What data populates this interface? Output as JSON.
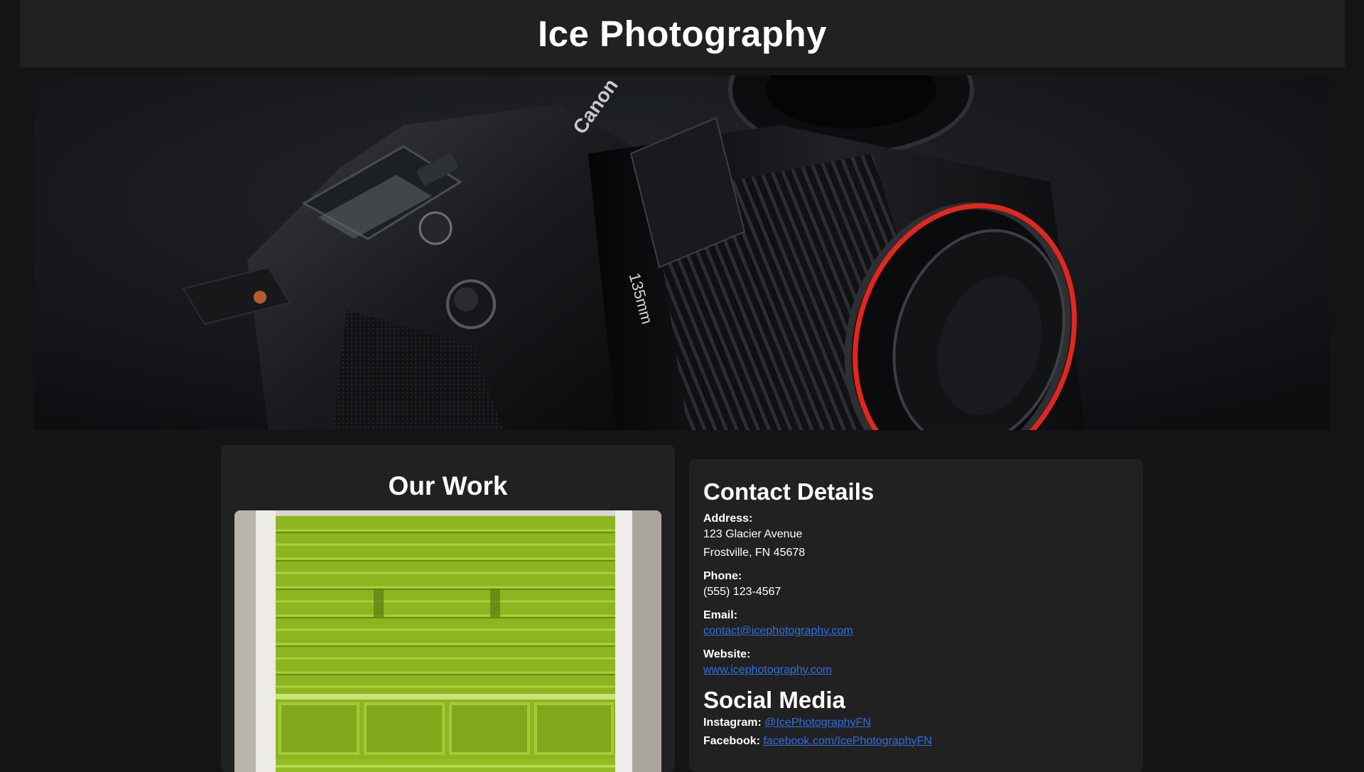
{
  "header": {
    "title": "Ice Photography"
  },
  "hero": {
    "image_alt": "Black Canon camera with a 135mm lens",
    "lens_text": "135mm",
    "brand_text": "Canon"
  },
  "work": {
    "title": "Our Work",
    "image_alt": "Bright green garage door"
  },
  "contact": {
    "title": "Contact Details",
    "address_label": "Address:",
    "address_line1": "123 Glacier Avenue",
    "address_line2": "Frostville, FN 45678",
    "phone_label": "Phone:",
    "phone_value": "(555) 123-4567",
    "email_label": "Email:",
    "email_value": "contact@icephotography.com",
    "website_label": "Website:",
    "website_value": "www.icephotography.com"
  },
  "social": {
    "title": "Social Media",
    "instagram_label": "Instagram:",
    "instagram_value": "@IcePhotographyFN",
    "facebook_label": "Facebook:",
    "facebook_value": "facebook.com/IcePhotographyFN"
  },
  "colors": {
    "page_bg": "#141414",
    "panel_bg": "#212121",
    "link": "#2f6fdf",
    "garage_green": "#8cb51f",
    "lens_red": "#e3261d"
  }
}
